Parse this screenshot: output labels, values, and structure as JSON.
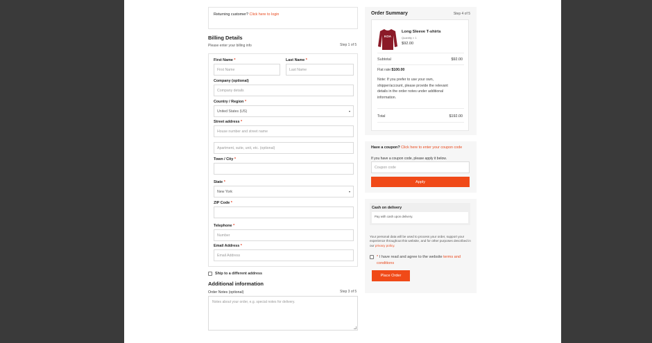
{
  "returning": {
    "text": "Returning customer?",
    "link": "Click here to login"
  },
  "billing": {
    "title": "Billing Details",
    "subtitle": "Please enter your billing info",
    "step": "Step 1 of 5",
    "fields": {
      "first_name": {
        "label": "First Name",
        "placeholder": "First Name"
      },
      "last_name": {
        "label": "Last Name",
        "placeholder": "Last Name"
      },
      "company": {
        "label": "Company (optional)",
        "placeholder": "Company details"
      },
      "country": {
        "label": "Country / Region",
        "value": "United States (US)"
      },
      "street": {
        "label": "Street address",
        "placeholder": "House number and street name",
        "placeholder2": "Apartment, suite, unit, etc. (optional)"
      },
      "town": {
        "label": "Town / City"
      },
      "state": {
        "label": "State",
        "value": "New York"
      },
      "zip": {
        "label": "ZIP Code"
      },
      "phone": {
        "label": "Telephone",
        "placeholder": "Number"
      },
      "email": {
        "label": "Email Address",
        "placeholder": "Email Address"
      }
    },
    "required_mark": "*"
  },
  "ship_different": "Ship to a different address",
  "additional": {
    "title": "Additional information",
    "notes_label": "Order Notes (optional)",
    "step": "Step 3 of 5",
    "notes_placeholder": "Notes about your order, e.g. special notes for delivery."
  },
  "summary": {
    "title": "Order Summary",
    "step": "Step 4 of 5",
    "product": {
      "name": "Long Sleeve T-shirts",
      "quantity": "Quantity × 1",
      "price": "$92.00",
      "shirt_text": "KOA"
    },
    "subtotal_label": "Subtotal",
    "subtotal_value": "$92.00",
    "flat_rate_label": "Flat rate:",
    "flat_rate_value": "$100.00",
    "note": "Note: If you prefer to use your own, shipper/account, please provide the relevant details in the order notes under additional information.",
    "total_label": "Total",
    "total_value": "$192.00"
  },
  "coupon": {
    "text": "Have a coupon?",
    "link": "Click here to enter your coupon code",
    "desc": "If you have a coupon code, please apply it below.",
    "placeholder": "Coupon code",
    "apply": "Apply"
  },
  "payment": {
    "method": "Cash on delivery",
    "desc": "Pay with cash upon delivery.",
    "privacy_text": "Your personal data will be used to process your order, support your experience throughout this website, and for other purposes described in our",
    "privacy_link": "privacy policy.",
    "terms_text": "I have read and agree to the website",
    "terms_link": "terms and conditions",
    "place_order": "Place Order"
  },
  "colors": {
    "accent": "#e8491d",
    "button": "#f04a18",
    "shirt": "#8b1a28"
  }
}
